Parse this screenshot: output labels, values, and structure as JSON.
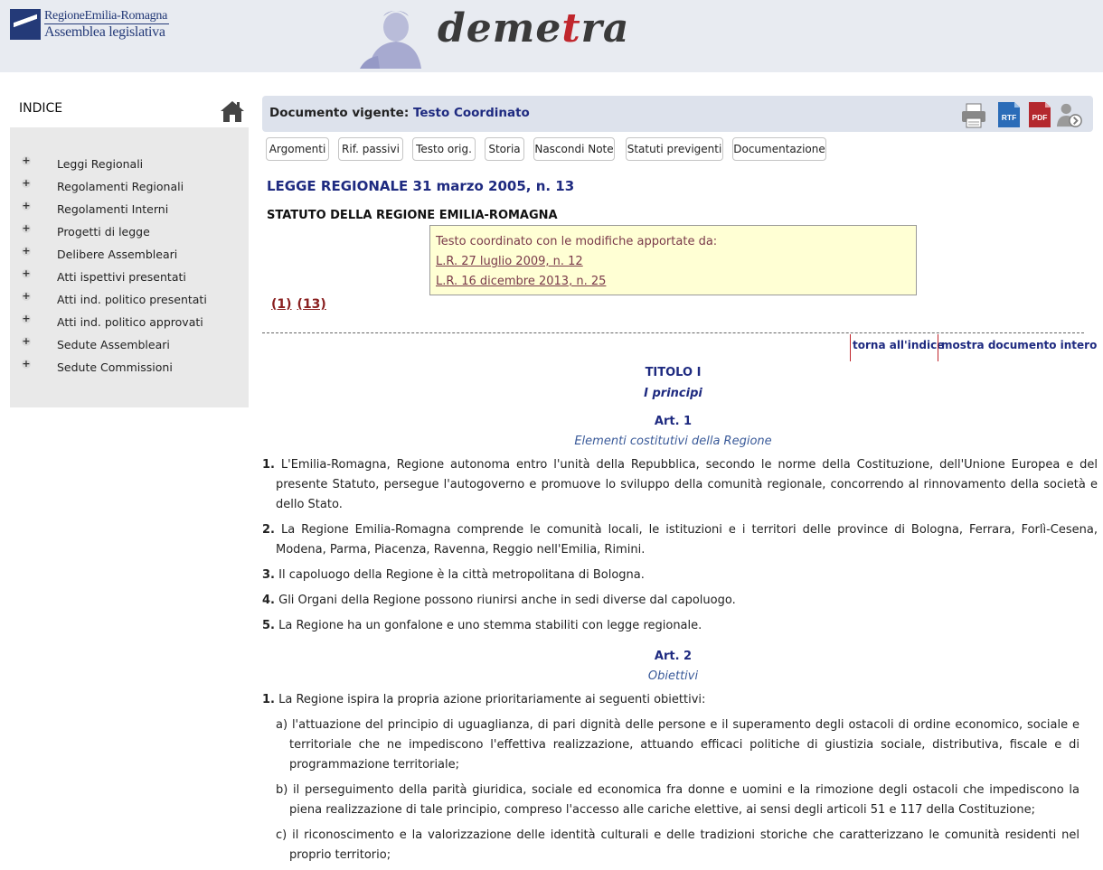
{
  "header": {
    "logo_line1": "RegioneEmilia-Romagna",
    "logo_line2": "Assemblea legislativa",
    "brand_prefix": "deme",
    "brand_red": "t",
    "brand_suffix": "ra"
  },
  "sidebar": {
    "tab_label": "INDICE",
    "items": [
      {
        "label": "Leggi Regionali"
      },
      {
        "label": "Regolamenti Regionali"
      },
      {
        "label": "Regolamenti Interni"
      },
      {
        "label": "Progetti di legge"
      },
      {
        "label": "Delibere Assembleari"
      },
      {
        "label": "Atti ispettivi presentati"
      },
      {
        "label": "Atti ind. politico presentati"
      },
      {
        "label": "Atti ind. politico approvati"
      },
      {
        "label": "Sedute Assembleari"
      },
      {
        "label": "Sedute Commissioni"
      }
    ],
    "plus_glyph": "+"
  },
  "docbar": {
    "label": "Documento vigente:",
    "value": "Testo Coordinato",
    "rtf_label": "RTF",
    "pdf_label": "PDF"
  },
  "buttons": [
    "Argomenti",
    "Rif. passivi",
    "Testo orig.",
    "Storia",
    "Nascondi Note",
    "Statuti previgenti",
    "Documentazione"
  ],
  "law": {
    "title": "LEGGE REGIONALE 31 marzo 2005, n. 13",
    "subtitle": "STATUTO DELLA REGIONE EMILIA-ROMAGNA"
  },
  "notebox": {
    "intro": "Testo coordinato con le modifiche apportate da:",
    "links": [
      "L.R. 27 luglio 2009, n. 12",
      "L.R. 16 dicembre 2013, n. 25"
    ]
  },
  "footrefs": [
    "(1)",
    "(13)"
  ],
  "nav": {
    "index": "torna all'indice",
    "full": "mostra documento intero"
  },
  "titolo": {
    "heading": "TITOLO I",
    "name": "I principi"
  },
  "art1": {
    "heading": "Art. 1",
    "subtitle": "Elementi costitutivi della Regione",
    "paras": [
      {
        "n": "1.",
        "text": "L'Emilia-Romagna, Regione autonoma entro l'unità della Repubblica, secondo le norme della Costituzione, dell'Unione Europea e del presente Statuto, persegue l'autogoverno e promuove lo sviluppo della comunità regionale, concorrendo al rinnovamento della società e dello Stato."
      },
      {
        "n": "2.",
        "text": "La Regione Emilia-Romagna comprende le comunità locali, le istituzioni e i territori delle province di Bologna, Ferrara, Forlì-Cesena, Modena, Parma, Piacenza, Ravenna, Reggio nell'Emilia, Rimini."
      },
      {
        "n": "3.",
        "text": "Il capoluogo della Regione è la città metropolitana di Bologna."
      },
      {
        "n": "4.",
        "text": "Gli Organi della Regione possono riunirsi anche in sedi diverse dal capoluogo."
      },
      {
        "n": "5.",
        "text": "La Regione ha un gonfalone e uno stemma stabiliti con legge regionale."
      }
    ]
  },
  "art2": {
    "heading": "Art. 2",
    "subtitle": "Obiettivi",
    "para1": {
      "n": "1.",
      "text": "La Regione ispira la propria azione prioritariamente ai seguenti obiettivi:"
    },
    "items": [
      "a) l'attuazione del principio di uguaglianza, di pari dignità delle persone e il superamento degli ostacoli di ordine economico, sociale e territoriale che ne impediscono l'effettiva realizzazione, attuando efficaci politiche di giustizia sociale, distributiva, fiscale e di programmazione territoriale;",
      "b) il perseguimento della parità giuridica, sociale ed economica fra donne e uomini e la rimozione degli ostacoli che impediscono la piena realizzazione di tale principio, compreso l'accesso alle cariche elettive, ai sensi degli articoli 51 e 117 della Costituzione;",
      "c) il riconoscimento e la valorizzazione delle identità culturali e delle tradizioni storiche che caratterizzano le comunità residenti nel proprio territorio;"
    ]
  }
}
